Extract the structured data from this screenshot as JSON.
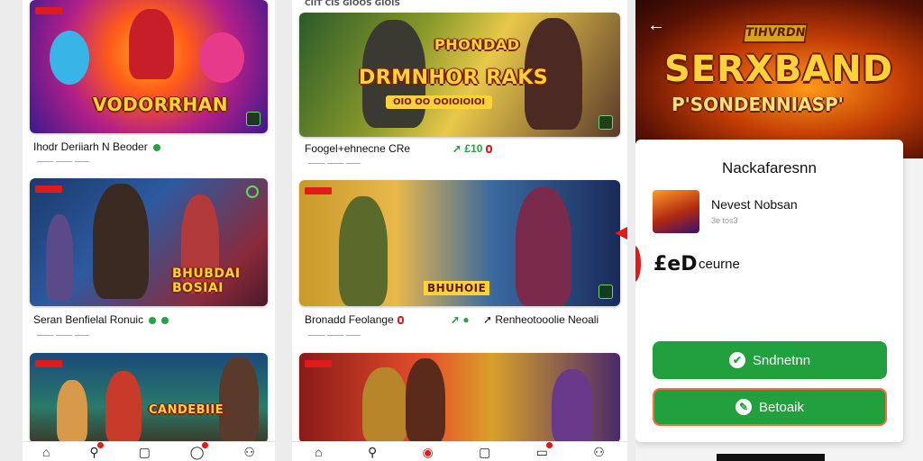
{
  "screen1": {
    "status_text": "",
    "cards": [
      {
        "banner": "VODORRHAN",
        "caption": "Ihodr Deriiarh N Beoder",
        "sub": "ــــــ ـــــــ ـــــــ"
      },
      {
        "banner": "BHUBDAI BOSIAI",
        "caption": "Seran Benfielal Ronuic",
        "sub": "ــــــ ـــــــ ـــــــ"
      },
      {
        "banner": "CANDEBIIE",
        "caption": "",
        "sub": ""
      }
    ],
    "nav": [
      "home-icon",
      "search-icon",
      "square-icon",
      "chat-icon",
      "profile-icon"
    ]
  },
  "screen2": {
    "status_text": "CIIT CIS GIOOS GIOIS",
    "cards": [
      {
        "banner": "DRMNHOR RAKS",
        "banner_top": "PHONDAD",
        "banner_sub": "OIO OO OOIOIOIOI",
        "caption": "Foogel+ehnecne CRe",
        "sub": "ــــــ ـــــــ ـــــــ",
        "badge": "➚ £10"
      },
      {
        "banner": "BHUHOIE",
        "caption": "Bronadd Feolange",
        "sub": "ــــــ ـــــــ ـــــــ",
        "extra": "➚ Renheotooolie Neoali"
      },
      {
        "banner": "",
        "caption": "",
        "sub": ""
      }
    ],
    "nav": [
      "home-icon",
      "search-icon",
      "record-icon",
      "square-icon",
      "chat-icon",
      "profile-icon"
    ]
  },
  "screen3": {
    "back": "←",
    "hero_small": "TIHVRDN",
    "hero_title": "SERXBAND",
    "hero_subtitle": "P'SONDENNIASP'",
    "sheet_title": "Nackafaresnn",
    "item_name": "Nevest Nobsan",
    "item_sub": "3e tos3",
    "price": "£eD",
    "price_suffix": "ceurne",
    "button_primary": "Sndnetnn",
    "button_secondary": "Betoaik"
  },
  "colors": {
    "accent_green": "#23a03e",
    "accent_red": "#e01b1b",
    "banner_gold": "#ffd23a"
  }
}
